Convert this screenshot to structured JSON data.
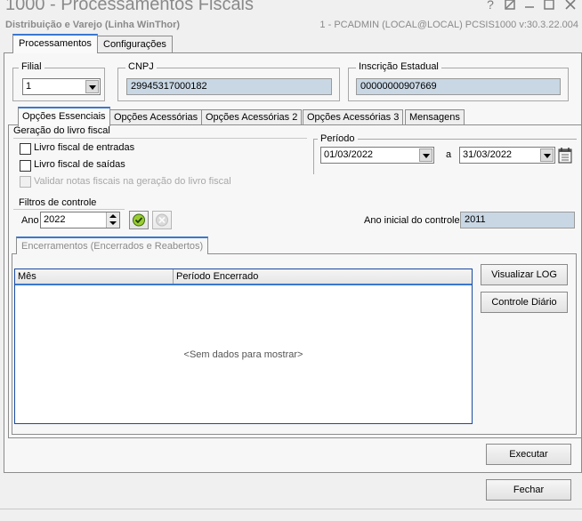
{
  "window": {
    "title": "1000 - Processamentos Fiscais",
    "subtitle": "Distribuição e Varejo (Linha WinThor)",
    "session_info": "1 - PCADMIN (LOCAL@LOCAL)   PCSIS1000  v:30.3.22.004",
    "controls": [
      "?",
      "help-icon",
      "minimize",
      "close"
    ]
  },
  "main_tabs": [
    {
      "label": "Processamentos",
      "active": true
    },
    {
      "label": "Configurações",
      "active": false
    }
  ],
  "header_fields": {
    "filial_label": "Filial",
    "filial_value": "1",
    "cnpj_label": "CNPJ",
    "cnpj_value": "29945317000182",
    "ie_label": "Inscrição Estadual",
    "ie_value": "00000000907669"
  },
  "sub_tabs": [
    {
      "label": "Opções Essenciais",
      "active": true
    },
    {
      "label": "Opções Acessórias",
      "active": false
    },
    {
      "label": "Opções Acessórias 2",
      "active": false
    },
    {
      "label": "Opções Acessórias 3",
      "active": false
    },
    {
      "label": "Mensagens",
      "active": false
    }
  ],
  "geracao": {
    "group_label": "Geração do livro fiscal",
    "livro_entradas": "Livro fiscal de entradas",
    "livro_saidas": "Livro fiscal de saídas",
    "validar_notas": "Validar notas fiscais na geração do livro fiscal"
  },
  "periodo": {
    "label": "Período",
    "start": "01/03/2022",
    "separator": "a",
    "end": "31/03/2022"
  },
  "filtros": {
    "group_label": "Filtros de controle",
    "ano_label": "Ano",
    "ano_value": "2022",
    "ano_inicial_label": "Ano inicial do controle",
    "ano_inicial_value": "2011"
  },
  "encerramentos": {
    "tab_label": "Encerramentos (Encerrados e Reabertos)",
    "columns": [
      "Mês",
      "Período Encerrado"
    ],
    "empty_text": "<Sem dados para mostrar>",
    "visualizar_log": "Visualizar LOG",
    "controle_diario": "Controle Diário"
  },
  "footer": {
    "executar": "Executar",
    "fechar": "Fechar"
  }
}
